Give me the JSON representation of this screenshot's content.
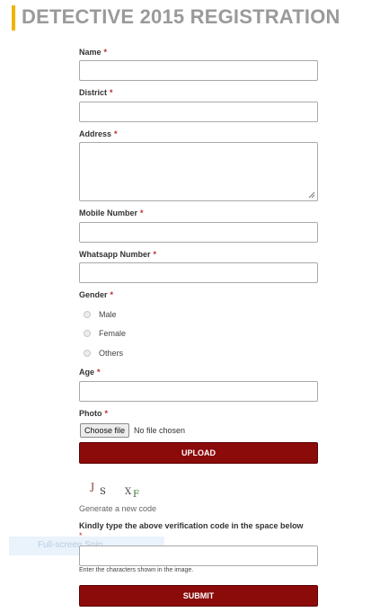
{
  "page": {
    "title": "DETECTIVE 2015 REGISTRATION"
  },
  "required_marker": "*",
  "form": {
    "name": {
      "label": "Name",
      "value": ""
    },
    "district": {
      "label": "District",
      "value": ""
    },
    "address": {
      "label": "Address",
      "value": ""
    },
    "mobile": {
      "label": "Mobile Number",
      "value": ""
    },
    "whatsapp": {
      "label": "Whatsapp Number",
      "value": ""
    },
    "gender": {
      "label": "Gender",
      "options": [
        "Male",
        "Female",
        "Others"
      ]
    },
    "age": {
      "label": "Age",
      "value": ""
    },
    "photo": {
      "label": "Photo",
      "choose_file_label": "Choose file",
      "file_status": "No file chosen",
      "upload_label": "UPLOAD"
    },
    "captcha": {
      "chars": [
        "J",
        "S",
        "X",
        "F"
      ],
      "char_colors": [
        "#7a1111",
        "#333333",
        "#444444",
        "#2f6e1f"
      ],
      "regenerate_label": "Generate a new code",
      "instruction": "Kindly type the above verification code in the space below",
      "value": "",
      "hint": "Enter the characters shown in the image."
    },
    "submit_label": "SUBMIT"
  },
  "overlay": {
    "text": "Full-screen Snip"
  },
  "colors": {
    "accent": "#f0b400",
    "button": "#8b0a0a",
    "required": "#c0272d"
  }
}
